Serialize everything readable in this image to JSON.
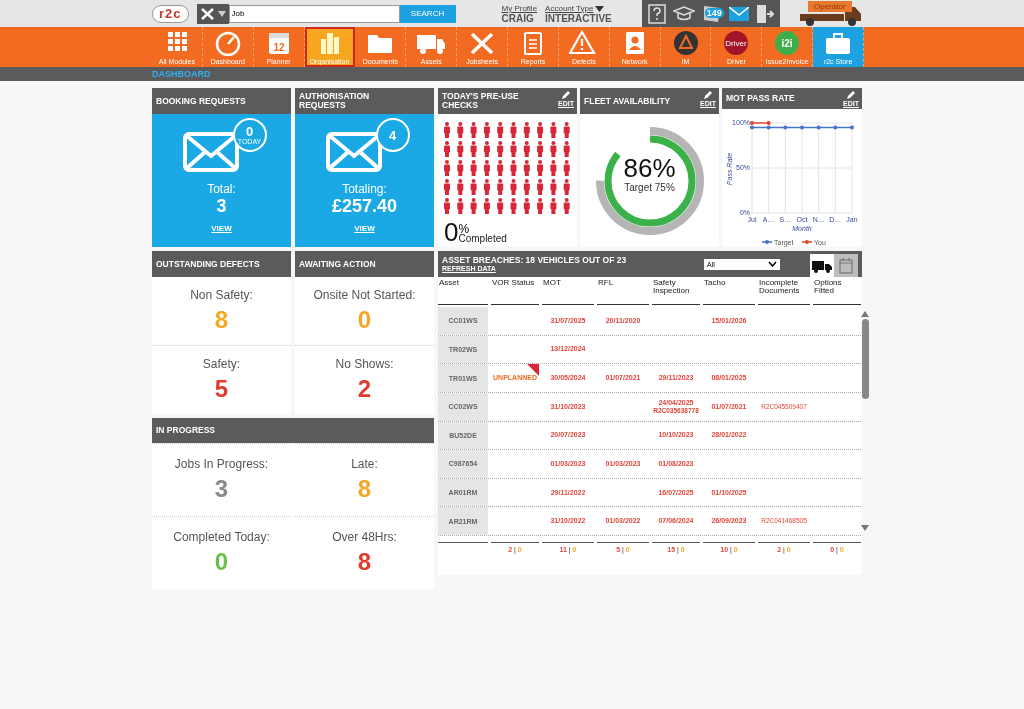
{
  "top_bar": {
    "logo": "r2c",
    "search": {
      "value": "Job"
    },
    "search_button": "SEARCH",
    "profile": {
      "link": "My Profile",
      "name": "CRAIG"
    },
    "account": {
      "link": "Account Type",
      "value": "INTERACTIVE"
    },
    "news_count": "149",
    "operator": "Operator"
  },
  "modules": [
    {
      "label": "All Modules",
      "kind": "module",
      "selected": false
    },
    {
      "label": "Dashboard",
      "kind": "module",
      "selected": false
    },
    {
      "label": "Planner",
      "kind": "module",
      "selected": false,
      "icon_text": "12"
    },
    {
      "label": "Organisation",
      "kind": "module",
      "selected": true
    },
    {
      "label": "Documents",
      "kind": "module",
      "selected": false
    },
    {
      "label": "Assets",
      "kind": "module",
      "selected": false
    },
    {
      "label": "Jobsheets",
      "kind": "module",
      "selected": false
    },
    {
      "label": "Reports",
      "kind": "module",
      "selected": false
    },
    {
      "label": "Defects",
      "kind": "module",
      "selected": false
    },
    {
      "label": "Network",
      "kind": "module",
      "selected": false
    },
    {
      "label": "IM",
      "kind": "module",
      "selected": false
    },
    {
      "label": "Driver",
      "kind": "module",
      "selected": false,
      "icon_text": "Driver"
    },
    {
      "label": "Issue2Invoice",
      "kind": "module",
      "selected": false,
      "icon_text": "i2i"
    },
    {
      "label": "r2c Store",
      "kind": "store",
      "selected": false
    }
  ],
  "page_title": "DASHBOARD",
  "request_tiles": [
    {
      "title": "BOOKING REQUESTS",
      "badge": "0",
      "badge_note": "TODAY",
      "caption": "Total:",
      "value": "3",
      "link": "VIEW"
    },
    {
      "title": "AUTHORISATION REQUESTS",
      "badge": "4",
      "caption": "Totaling:",
      "value": "£257.40",
      "link": "VIEW"
    }
  ],
  "stat_panels": [
    {
      "title": "OUTSTANDING DEFECTS",
      "stats": [
        {
          "label": "Non Safety:",
          "value": "8",
          "color": "#f5a623"
        },
        {
          "label": "Safety:",
          "value": "5",
          "color": "#e03c2d"
        }
      ]
    },
    {
      "title": "AWAITING ACTION",
      "stats": [
        {
          "label": "Onsite Not Started:",
          "value": "0",
          "color": "#f5a623"
        },
        {
          "label": "No Shows:",
          "value": "2",
          "color": "#e03c2d"
        }
      ]
    }
  ],
  "in_progress": {
    "title": "IN PROGRESS",
    "stats": [
      {
        "label": "Jobs In Progress:",
        "value": "3",
        "color": "#8a8a8a"
      },
      {
        "label": "Late:",
        "value": "8",
        "color": "#f5a623"
      },
      {
        "label": "Completed Today:",
        "value": "0",
        "color": "#6cbf4a"
      },
      {
        "label": "Over 48Hrs:",
        "value": "8",
        "color": "#e03c2d"
      }
    ]
  },
  "pre_use_checks": {
    "title": "TODAY'S PRE-USE CHECKS",
    "edit": "EDIT",
    "value": "0",
    "unit": "%",
    "caption": "Completed"
  },
  "fleet_availability": {
    "title": "FLEET AVAILABILITY",
    "edit": "EDIT",
    "level": 0.86,
    "value": "86%",
    "target": "Target 75%"
  },
  "mot_pass_rate": {
    "title": "MOT PASS RATE",
    "edit": "EDIT",
    "chart_data": {
      "type": "line",
      "grid": true,
      "legend": true,
      "xlabel": "Month",
      "ylabel": "Pass Rate",
      "categories": [
        "Jul",
        "A…",
        "S…",
        "Oct",
        "N…",
        "D…",
        "Jan"
      ],
      "ylim": [
        0,
        100
      ],
      "yticks": [
        {
          "value": 0,
          "label": "0%"
        },
        {
          "value": 50,
          "label": "50%"
        },
        {
          "value": 100,
          "label": "100%"
        }
      ],
      "series": [
        {
          "name": "Target",
          "color": "#4a72c8",
          "values": [
            95,
            95,
            95,
            95,
            95,
            95,
            95
          ]
        },
        {
          "name": "You",
          "color": "#e0452c",
          "values": [
            100,
            100,
            null,
            null,
            null,
            null,
            null
          ]
        }
      ]
    }
  },
  "asset_breaches": {
    "title": "ASSET BREACHES: 18 VEHICLES OUT OF 23",
    "refresh": "REFRESH DATA",
    "filter": "All",
    "views": [
      {
        "kind": "vehicles",
        "selected": true
      },
      {
        "kind": "calendar",
        "selected": false
      }
    ],
    "columns": [
      {
        "label": "Asset",
        "kind": "asset"
      },
      {
        "label": "VOR Status",
        "kind": "vor"
      },
      {
        "label": "MOT",
        "kind": "date"
      },
      {
        "label": "RFL",
        "kind": "date"
      },
      {
        "label": "Safety Inspection",
        "kind": "date"
      },
      {
        "label": "Tacho",
        "kind": "date"
      },
      {
        "label": "Incomplete Documents",
        "kind": "ref"
      },
      {
        "label": "Options Fitted",
        "kind": "date"
      }
    ],
    "rows": [
      {
        "cells": [
          "CC01WS",
          "",
          "31/07/2025",
          "20/11/2020",
          "",
          "15/01/2026",
          "",
          ""
        ]
      },
      {
        "cells": [
          "TR02WS",
          "",
          "13/12/2024",
          "",
          "",
          "",
          "",
          ""
        ]
      },
      {
        "cells": [
          "TR01WS",
          {
            "text": "UNPLANNED",
            "flagged": true
          },
          "30/05/2024",
          "01/07/2021",
          "29/11/2023",
          "08/01/2025",
          "",
          ""
        ]
      },
      {
        "cells": [
          "CC02WS",
          "",
          "31/10/2023",
          "",
          {
            "text": "24/04/2025",
            "ref": "R2C035638778"
          },
          "01/07/2021",
          "R2C045509407",
          ""
        ]
      },
      {
        "cells": [
          "BU52DE",
          "",
          "20/07/2023",
          "",
          "10/10/2023",
          "28/01/2022",
          "",
          ""
        ]
      },
      {
        "cells": [
          "C987654",
          "",
          "01/03/2023",
          "01/03/2023",
          "01/08/2023",
          "",
          "",
          ""
        ]
      },
      {
        "cells": [
          "AR01RM",
          "",
          "29/11/2022",
          "",
          "16/07/2025",
          "01/10/2025",
          "",
          ""
        ]
      },
      {
        "cells": [
          "AR21RM",
          "",
          "31/10/2022",
          "01/03/2022",
          "07/06/2024",
          "26/09/2023",
          "R2C041468505",
          ""
        ]
      }
    ],
    "separator": "|",
    "totals": [
      {
        "breached": "2",
        "due": "0"
      },
      {
        "breached": "11",
        "due": "0"
      },
      {
        "breached": "5",
        "due": "0"
      },
      {
        "breached": "15",
        "due": "0"
      },
      {
        "breached": "10",
        "due": "0"
      },
      {
        "breached": "2",
        "due": "0"
      },
      {
        "breached": "0",
        "due": "0"
      }
    ]
  }
}
